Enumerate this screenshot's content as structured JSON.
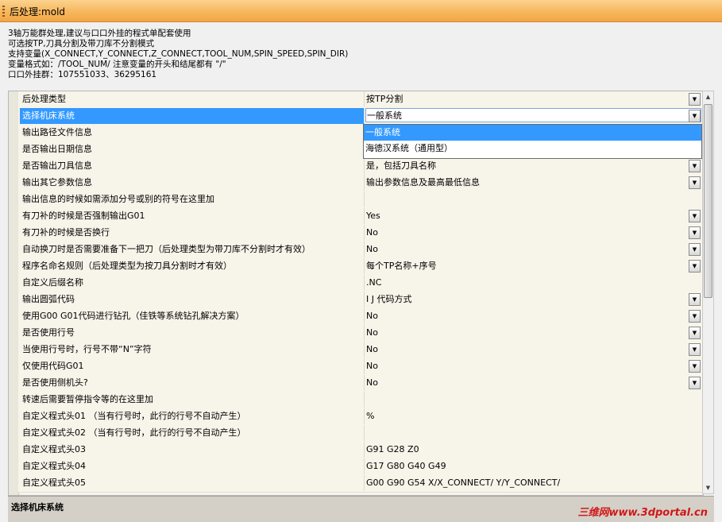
{
  "window": {
    "title": "后处理:mold"
  },
  "description": [
    "3轴万能群处理,建议与口口外挂的程式单配套使用",
    "可选按TP,刀具分割及带刀库不分割模式",
    "支持变量(X_CONNECT,Y_CONNECT,Z_CONNECT,TOOL_NUM,SPIN_SPEED,SPIN_DIR)",
    "变量格式如：/TOOL_NUM/ 注意变量的开头和结尾都有 \"/\"",
    "口口外挂群：107551033、36295161"
  ],
  "rows": [
    {
      "label": "后处理类型",
      "value": "按TP分割",
      "dropdown": true
    },
    {
      "label": "选择机床系统",
      "value": "一般系统",
      "dropdown": true,
      "selected": true
    },
    {
      "label": "输出路径文件信息",
      "value": "",
      "dropdown": false
    },
    {
      "label": "是否输出日期信息",
      "value": "",
      "dropdown": false
    },
    {
      "label": "是否输出刀具信息",
      "value": "是，包括刀具名称",
      "dropdown": true
    },
    {
      "label": "输出其它参数信息",
      "value": "输出参数信息及最高最低信息",
      "dropdown": true
    },
    {
      "label": "输出信息的时候如需添加分号或别的符号在这里加",
      "value": "",
      "dropdown": false
    },
    {
      "label": "有刀补的时候是否强制输出G01",
      "value": "Yes",
      "dropdown": true
    },
    {
      "label": "有刀补的时候是否换行",
      "value": "No",
      "dropdown": true
    },
    {
      "label": "自动换刀时是否需要准备下一把刀（后处理类型为带刀库不分割时才有效）",
      "value": "No",
      "dropdown": true
    },
    {
      "label": "程序名命名规则（后处理类型为按刀具分割时才有效）",
      "value": "每个TP名称+序号",
      "dropdown": true
    },
    {
      "label": "自定义后缀名称",
      "value": ".NC",
      "dropdown": false
    },
    {
      "label": "输出圆弧代码",
      "value": "I J 代码方式",
      "dropdown": true
    },
    {
      "label": "使用G00 G01代码进行钻孔（佳铁等系统钻孔解决方案）",
      "value": "No",
      "dropdown": true
    },
    {
      "label": "是否使用行号",
      "value": "No",
      "dropdown": true
    },
    {
      "label": "当使用行号时，行号不带“N”字符",
      "value": "No",
      "dropdown": true
    },
    {
      "label": "仅使用代码G01",
      "value": "No",
      "dropdown": true
    },
    {
      "label": "是否使用侧机头?",
      "value": "No",
      "dropdown": true
    },
    {
      "label": "转速后需要暂停指令等的在这里加",
      "value": "",
      "dropdown": false
    },
    {
      "label": "自定义程式头01 （当有行号时，此行的行号不自动产生）",
      "value": "%",
      "dropdown": false
    },
    {
      "label": "自定义程式头02 （当有行号时，此行的行号不自动产生）",
      "value": "",
      "dropdown": false
    },
    {
      "label": "自定义程式头03",
      "value": "G91 G28 Z0",
      "dropdown": false
    },
    {
      "label": "自定义程式头04",
      "value": "G17 G80 G40 G49",
      "dropdown": false
    },
    {
      "label": "自定义程式头05",
      "value": "G00 G90 G54 X/X_CONNECT/ Y/Y_CONNECT/",
      "dropdown": false
    }
  ],
  "dropdown_options": [
    "一般系统",
    "海德汉系统（通用型）"
  ],
  "help": {
    "title": "选择机床系统"
  },
  "watermark": "三维网www.3dportal.cn",
  "icons": {
    "dropdown": "chevron-down-icon",
    "scroll_up": "arrow-up-icon",
    "scroll_down": "arrow-down-icon"
  }
}
